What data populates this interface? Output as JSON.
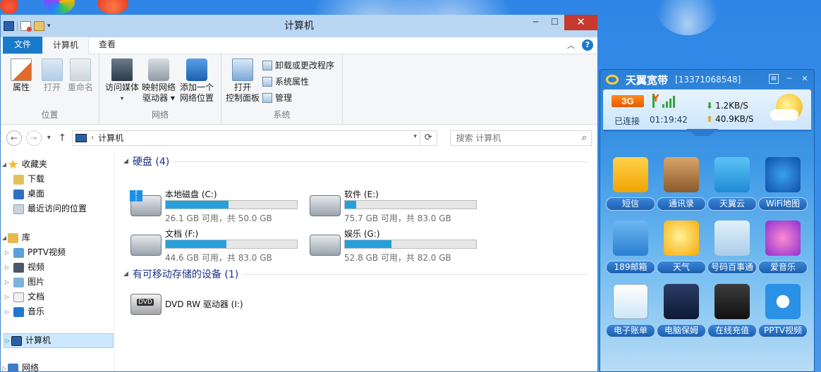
{
  "explorer": {
    "title": "计算机",
    "tabs": [
      "文件",
      "计算机",
      "查看"
    ],
    "ribbon": {
      "location": {
        "label": "位置",
        "buttons": [
          "属性",
          "打开",
          "重命名"
        ]
      },
      "network": {
        "label": "网络",
        "buttons": [
          [
            "访问媒体"
          ],
          [
            "映射网络",
            "驱动器"
          ],
          [
            "添加一个",
            "网络位置"
          ]
        ]
      },
      "system": {
        "label": "系统",
        "open_cpanel": [
          "打开",
          "控制面板"
        ],
        "small": [
          "卸载或更改程序",
          "系统属性",
          "管理"
        ]
      }
    },
    "address": {
      "crumb": "计算机"
    },
    "search": {
      "placeholder": "搜索 计算机"
    },
    "nav": {
      "favorites": "收藏夹",
      "fav_items": [
        "下载",
        "桌面",
        "最近访问的位置"
      ],
      "library": "库",
      "lib_items": [
        "PPTV视频",
        "视频",
        "图片",
        "文档",
        "音乐"
      ],
      "computer": "计算机",
      "network": "网络"
    },
    "sections": {
      "hard_disks": "硬盘 (4)",
      "removable": "有可移动存储的设备 (1)"
    },
    "drives": [
      {
        "name": "本地磁盘 (C:)",
        "info": "26.1 GB 可用，共 50.0 GB",
        "used_fraction": 0.478
      },
      {
        "name": "软件 (E:)",
        "info": "75.7 GB 可用，共 83.0 GB",
        "used_fraction": 0.088
      },
      {
        "name": "文档 (F:)",
        "info": "44.6 GB 可用，共 83.0 GB",
        "used_fraction": 0.463
      },
      {
        "name": "娱乐 (G:)",
        "info": "52.8 GB 可用，共 82.0 GB",
        "used_fraction": 0.356
      }
    ],
    "dvd": {
      "name": "DVD RW 驱动器 (I:)"
    }
  },
  "tianyi": {
    "title": "天翼宽带",
    "phone": "[13371068548]",
    "network": "3G",
    "status": "已连接",
    "duration": "01:19:42",
    "download_speed": "1.2KB/S",
    "upload_speed": "40.9KB/S",
    "tiles": [
      "短信",
      "通讯录",
      "天翼云",
      "WiFi地图",
      "189邮箱",
      "天气",
      "号码百事通",
      "爱音乐",
      "电子账单",
      "电脑保姆",
      "在线充值",
      "PPTV视频"
    ]
  },
  "colors": {
    "accent": "#1979ca",
    "progress": "#26a0da",
    "tianyi_blue": "#2b7fd6"
  }
}
